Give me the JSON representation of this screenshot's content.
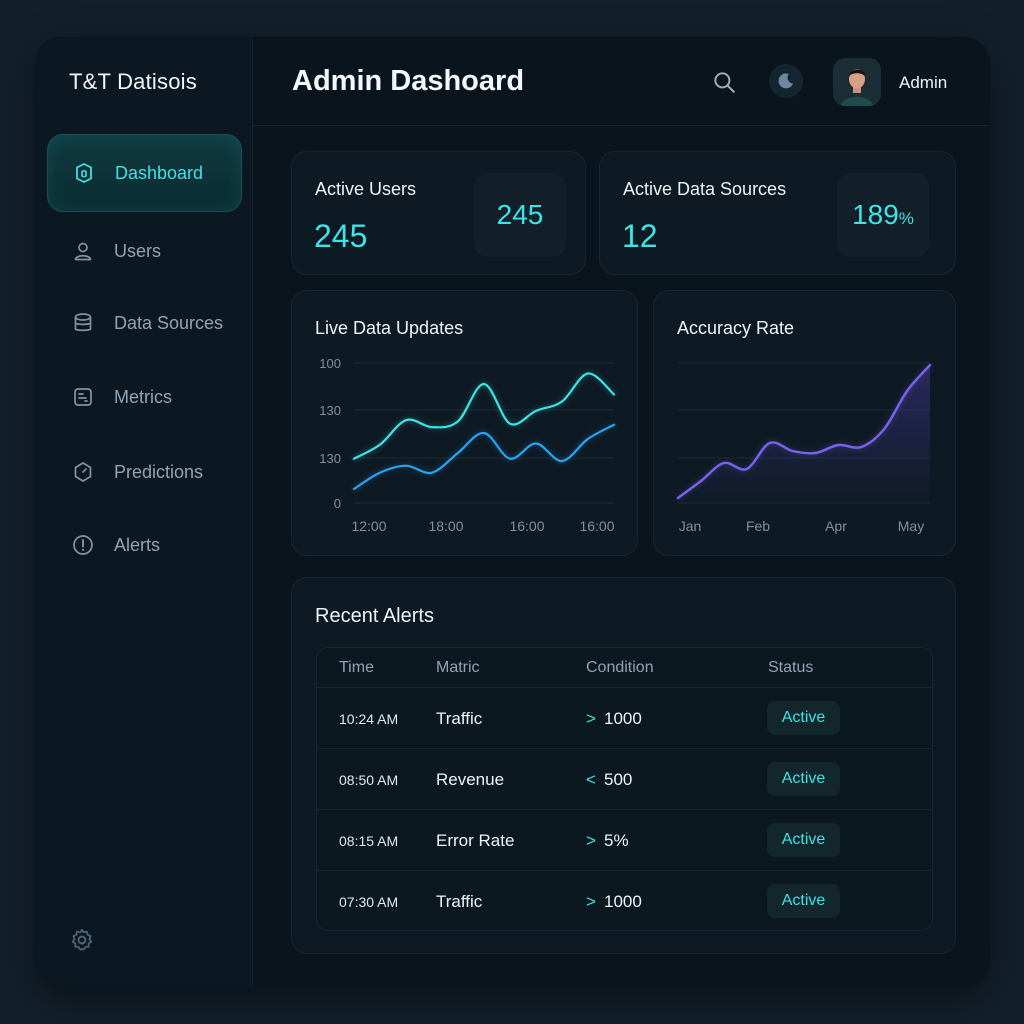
{
  "app": {
    "brand": "T&T Datisois"
  },
  "sidebar": {
    "items": [
      {
        "label": "Dashboard",
        "icon": "dashboard-icon",
        "active": true
      },
      {
        "label": "Users",
        "icon": "user-icon",
        "active": false
      },
      {
        "label": "Data Sources",
        "icon": "database-icon",
        "active": false
      },
      {
        "label": "Metrics",
        "icon": "metrics-icon",
        "active": false
      },
      {
        "label": "Predictions",
        "icon": "predictions-icon",
        "active": false
      },
      {
        "label": "Alerts",
        "icon": "alert-icon",
        "active": false
      }
    ],
    "footer_icon": "gear-icon"
  },
  "header": {
    "title": "Admin Dashoard",
    "user_name": "Admin",
    "icons": [
      "search-icon",
      "moon-icon",
      "avatar"
    ]
  },
  "stats": [
    {
      "title": "Active Users",
      "value": "245",
      "box_value": "245",
      "box_unit": ""
    },
    {
      "title": "Active Data Sources",
      "value": "12",
      "box_value": "189",
      "box_unit": "%"
    }
  ],
  "chart_data": [
    {
      "type": "line",
      "title": "Live Data Updates",
      "x_tick_labels": [
        "12:00",
        "18:00",
        "16:00",
        "16:00"
      ],
      "y_tick_labels": [
        "100",
        "130",
        "130",
        "0"
      ],
      "series": [
        {
          "color": "#3ee3e6",
          "values": [
            38,
            50,
            71,
            65,
            70,
            102,
            68,
            79,
            87,
            111,
            93
          ]
        },
        {
          "color": "#2aa3f0",
          "values": [
            12,
            26,
            32,
            26,
            43,
            60,
            38,
            51,
            36,
            55,
            67
          ]
        }
      ]
    },
    {
      "type": "area",
      "title": "Accuracy Rate",
      "x_tick_labels": [
        "Jan",
        "Feb",
        "Apr",
        "May"
      ],
      "series": [
        {
          "color": "#7b63f0",
          "values": [
            5,
            22,
            40,
            34,
            60,
            52,
            50,
            58,
            56,
            74,
            112,
            138
          ]
        }
      ]
    }
  ],
  "alerts": {
    "title": "Recent Alerts",
    "columns": [
      "Time",
      "Matric",
      "Condition",
      "Status"
    ],
    "rows": [
      {
        "time": "10:24 AM",
        "metric": "Traffic",
        "op": ">",
        "value": "1000",
        "status": "Active"
      },
      {
        "time": "08:50 AM",
        "metric": "Revenue",
        "op": "<",
        "value": "500",
        "status": "Active"
      },
      {
        "time": "08:15 AM",
        "metric": "Error Rate",
        "op": ">",
        "value": "5%",
        "status": "Active"
      },
      {
        "time": "07:30 AM",
        "metric": "Traffic",
        "op": ">",
        "value": "1000",
        "status": "Active"
      }
    ]
  },
  "colors": {
    "accent": "#3ee3e6",
    "accent_blue": "#2aa3f0",
    "accent_purple": "#7b63f0",
    "panel": "#0e1a23",
    "bg": "#13202b"
  }
}
